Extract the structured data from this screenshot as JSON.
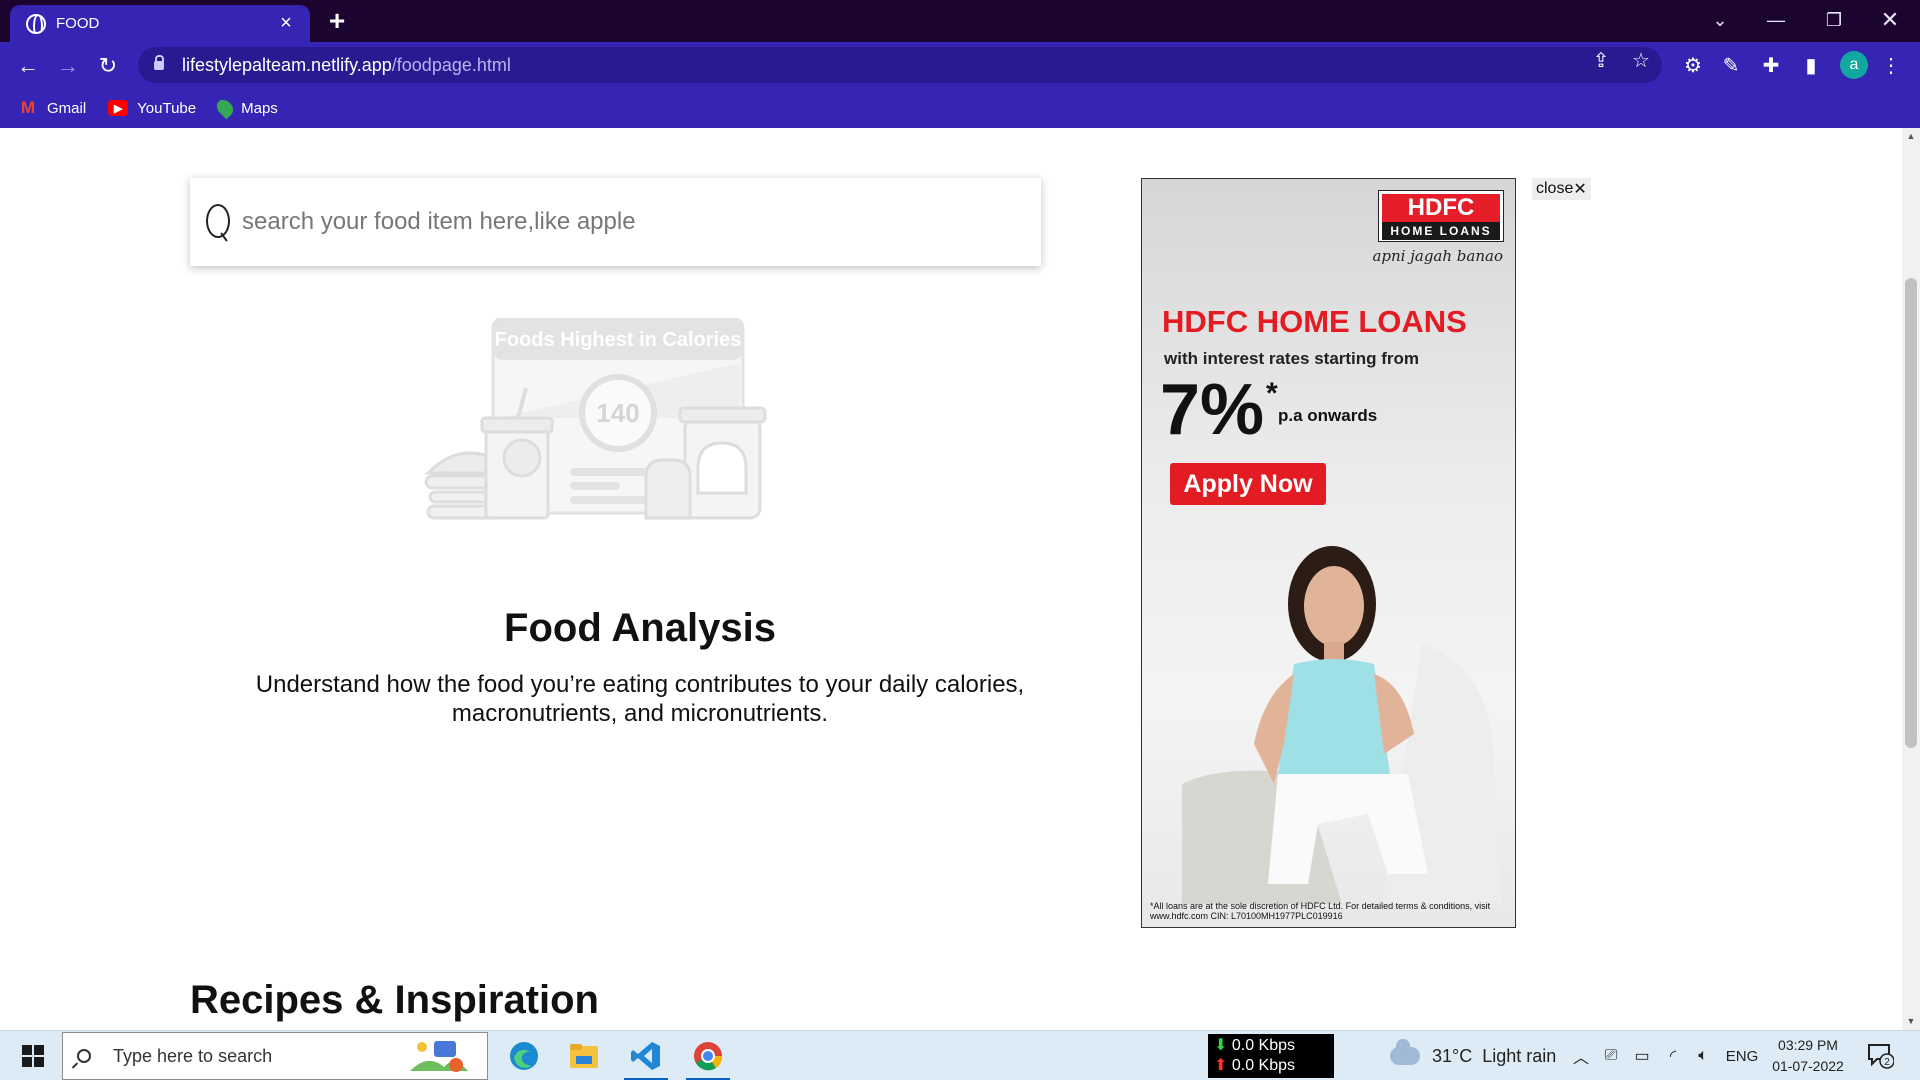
{
  "browser": {
    "tab_title": "FOOD",
    "url_host": "lifestylepalteam.netlify.app",
    "url_path": "/foodpage.html",
    "bookmarks": [
      "Gmail",
      "YouTube",
      "Maps"
    ],
    "profile_initial": "a"
  },
  "page": {
    "search_placeholder": "search your food item here,like apple",
    "illustration_banner": "Foods Highest in Calories",
    "illustration_gauge": "140",
    "heading": "Food Analysis",
    "description_line1": "Understand how the food you’re eating contributes to your daily calories,",
    "description_line2": "macronutrients, and micronutrients.",
    "section_heading": "Recipes & Inspiration"
  },
  "ad": {
    "logo_main": "HDFC",
    "logo_sub": "HOME LOANS",
    "logo_tagline": "apni jagah banao",
    "headline": "HDFC HOME LOANS",
    "subline": "with interest rates starting from",
    "rate": "7%",
    "rate_star": "*",
    "rate_suffix": "p.a onwards",
    "cta": "Apply Now",
    "fine_print": "*All loans are at the sole discretion of HDFC Ltd. For detailed terms & conditions, visit www.hdfc.com CIN: L70100MH1977PLC019916",
    "close_label": "close",
    "close_glyph": "✕",
    "brand_red": "#e31b23"
  },
  "taskbar": {
    "search_placeholder": "Type here to search",
    "net_down": "0.0 Kbps",
    "net_up": "0.0 Kbps",
    "weather": "31°C  Light rain",
    "lang": "ENG",
    "time": "03:29 PM",
    "date": "01-07-2022",
    "notification_count": "2"
  },
  "colors": {
    "chrome_dark": "#1c0430",
    "chrome_accent": "#3625b4",
    "taskbar_bg": "#dcebf5"
  }
}
